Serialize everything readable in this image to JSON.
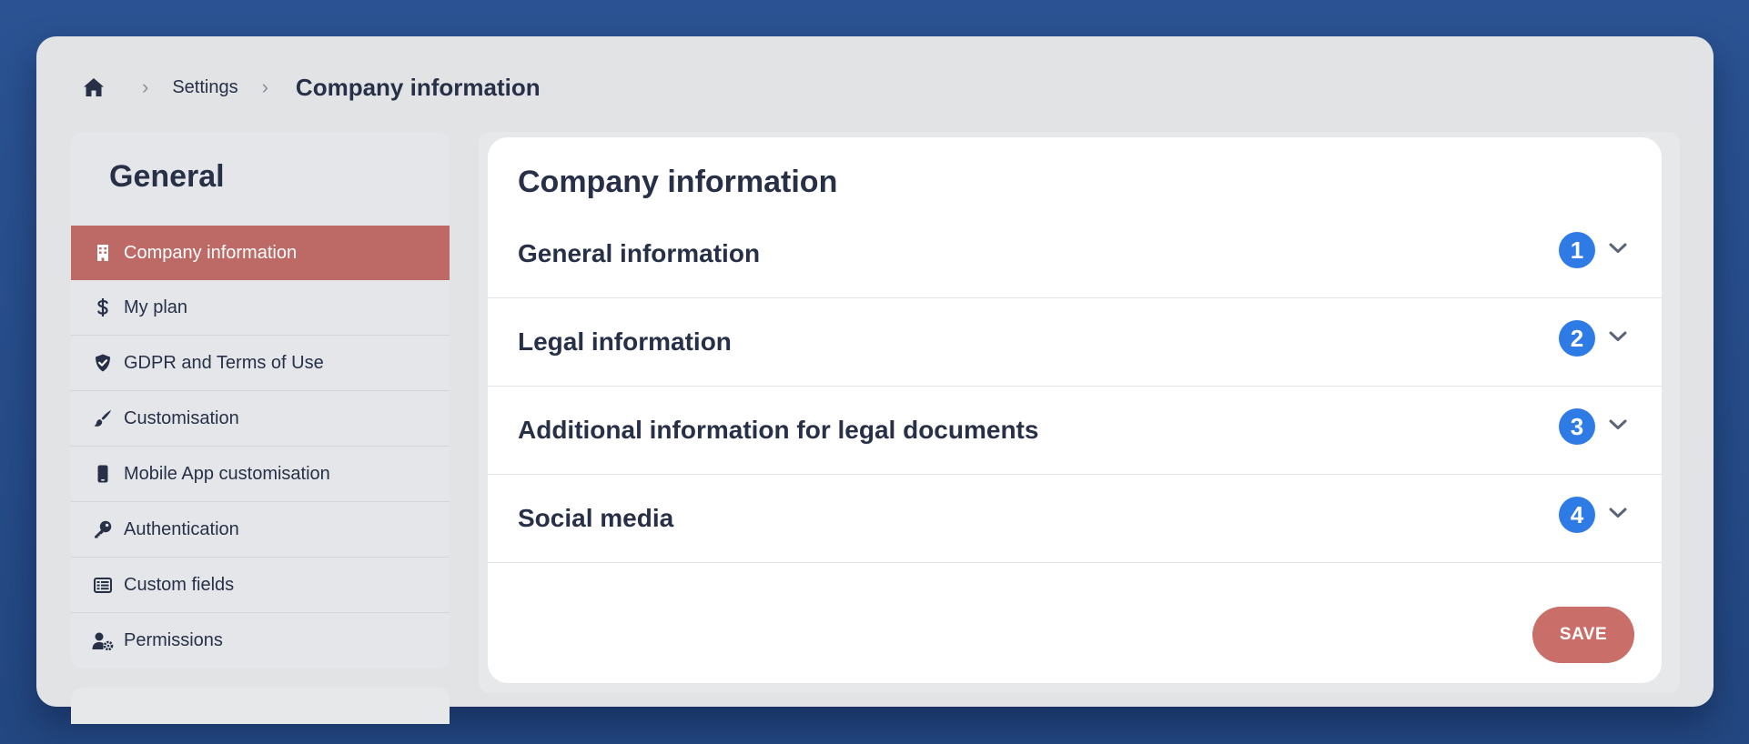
{
  "breadcrumb": {
    "home_icon": "home-icon",
    "items": [
      "Settings",
      "Company information"
    ]
  },
  "sidebar": {
    "title": "General",
    "items": [
      {
        "label": "Company information",
        "icon": "building-icon",
        "active": true
      },
      {
        "label": "My plan",
        "icon": "dollar-icon"
      },
      {
        "label": "GDPR and Terms of Use",
        "icon": "shield-check-icon"
      },
      {
        "label": "Customisation",
        "icon": "paintbrush-icon"
      },
      {
        "label": "Mobile App customisation",
        "icon": "mobile-icon"
      },
      {
        "label": "Authentication",
        "icon": "key-icon"
      },
      {
        "label": "Custom fields",
        "icon": "table-list-icon"
      },
      {
        "label": "Permissions",
        "icon": "user-gear-icon"
      }
    ]
  },
  "main": {
    "title": "Company information",
    "sections": [
      {
        "label": "General information",
        "badge": "1"
      },
      {
        "label": "Legal information",
        "badge": "2"
      },
      {
        "label": "Additional information for legal documents",
        "badge": "3"
      },
      {
        "label": "Social media",
        "badge": "4"
      }
    ],
    "save_label": "SAVE"
  },
  "colors": {
    "background": "#2b5393",
    "panel": "#e1e3e5",
    "active_item": "#bd6a67",
    "badge": "#2f7be6",
    "save_button": "#c96e69",
    "text": "#283047"
  }
}
